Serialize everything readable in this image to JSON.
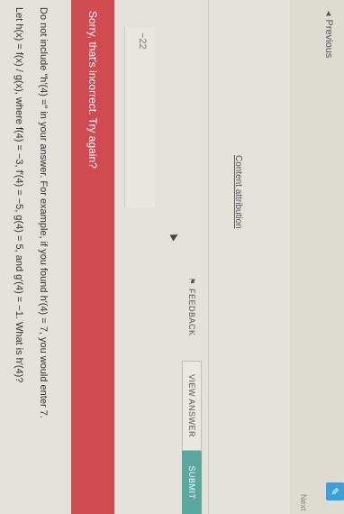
{
  "question": {
    "line1": "Let h(x) = f(x) / g(x), where f(4) = −3, f′(4) = −5, g(4) = 5, and g′(4) = −1. What is h′(4)?",
    "line2": "Do not include \"h′(4) =\" in your answer. For example, if you found h′(4) = 7, you would enter 7."
  },
  "feedback_banner": "Sorry, that's incorrect. Try again?",
  "answer_value": "−22",
  "buttons": {
    "feedback": "FEEDBACK",
    "view_answer": "VIEW ANSWER",
    "submit": "SUBMIT"
  },
  "links": {
    "attribution": "Content attribution",
    "previous": "Previous",
    "next": "Next"
  },
  "icons": {
    "previous": "chevron-left-icon",
    "feedback": "flag-icon",
    "edit": "pencil-icon"
  },
  "colors": {
    "error_banner": "#cf4b52",
    "submit_button": "#5aa7a0",
    "edit_button": "#3aa0d6"
  }
}
